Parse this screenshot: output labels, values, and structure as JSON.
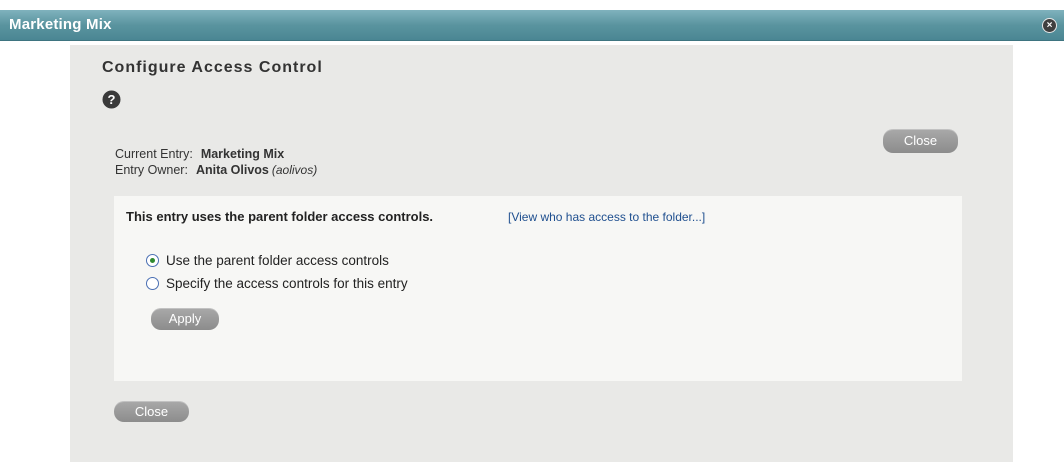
{
  "window": {
    "title": "Marketing Mix",
    "close_glyph": "×"
  },
  "dialog": {
    "title": "Configure Access Control",
    "help_icon": "question-circle-icon",
    "close_label": "Close"
  },
  "entry": {
    "current_label": "Current Entry:",
    "current_value": "Marketing Mix",
    "owner_label": "Entry Owner:",
    "owner_name": "Anita Olivos",
    "owner_id": "(aolivos)"
  },
  "panel": {
    "heading": "This entry uses the parent folder access controls.",
    "link": "[View who has access to the folder...]",
    "options": [
      {
        "label": "Use the parent folder access controls",
        "selected": true
      },
      {
        "label": "Specify the access controls for this entry",
        "selected": false
      }
    ],
    "apply_label": "Apply"
  },
  "colors": {
    "titlebar": "#5a949f",
    "dialog_bg": "#e9e9e7",
    "panel_bg": "#f7f7f5",
    "button": "#9a9a9a",
    "link": "#1f4f8f"
  }
}
